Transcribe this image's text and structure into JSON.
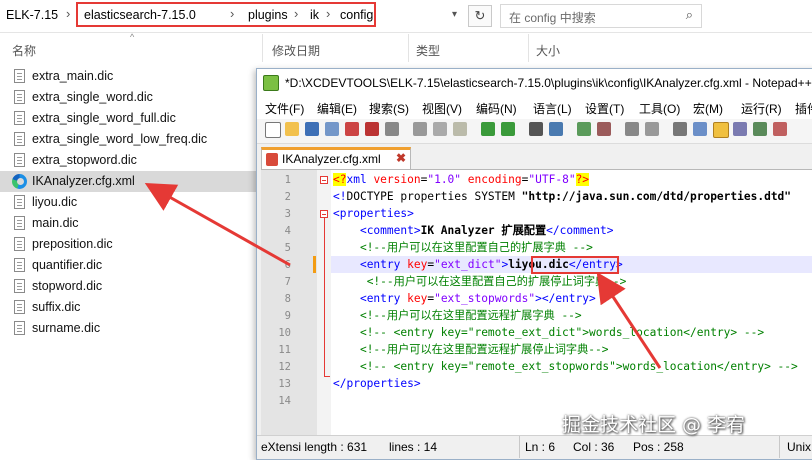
{
  "explorer": {
    "crumbs": [
      "ELK-7.15",
      "elasticsearch-7.15.0",
      "plugins",
      "ik",
      "config"
    ],
    "search_placeholder": "在 config 中搜索",
    "columns": {
      "name": "名称",
      "modified": "修改日期",
      "type": "类型",
      "size": "大小"
    },
    "files": [
      {
        "name": "extra_main.dic",
        "icon": "document-icon"
      },
      {
        "name": "extra_single_word.dic",
        "icon": "document-icon"
      },
      {
        "name": "extra_single_word_full.dic",
        "icon": "document-icon"
      },
      {
        "name": "extra_single_word_low_freq.dic",
        "icon": "document-icon"
      },
      {
        "name": "extra_stopword.dic",
        "icon": "document-icon"
      },
      {
        "name": "IKAnalyzer.cfg.xml",
        "icon": "edge-icon",
        "selected": true
      },
      {
        "name": "liyou.dic",
        "icon": "document-icon"
      },
      {
        "name": "main.dic",
        "icon": "document-icon"
      },
      {
        "name": "preposition.dic",
        "icon": "document-icon"
      },
      {
        "name": "quantifier.dic",
        "icon": "document-icon"
      },
      {
        "name": "stopword.dic",
        "icon": "document-icon"
      },
      {
        "name": "suffix.dic",
        "icon": "document-icon"
      },
      {
        "name": "surname.dic",
        "icon": "document-icon"
      }
    ]
  },
  "notepad": {
    "title": "*D:\\XCDEVTOOLS\\ELK-7.15\\elasticsearch-7.15.0\\plugins\\ik\\config\\IKAnalyzer.cfg.xml - Notepad++",
    "menu": [
      "文件(F)",
      "编辑(E)",
      "搜索(S)",
      "视图(V)",
      "编码(N)",
      "语言(L)",
      "设置(T)",
      "工具(O)",
      "宏(M)",
      "运行(R)",
      "插件"
    ],
    "tab_label": "IKAnalyzer.cfg.xml",
    "tab_close": "✖",
    "line_numbers": [
      "1",
      "2",
      "3",
      "4",
      "5",
      "6",
      "7",
      "8",
      "9",
      "10",
      "11",
      "12",
      "13",
      "14"
    ],
    "code": [
      [
        {
          "c": "pi",
          "t": "<?"
        },
        {
          "c": "tag",
          "t": "xml "
        },
        {
          "c": "attr",
          "t": "version"
        },
        {
          "c": "txt",
          "t": "="
        },
        {
          "c": "val",
          "t": "\"1.0\""
        },
        {
          "c": "attr",
          "t": " encoding"
        },
        {
          "c": "txt",
          "t": "="
        },
        {
          "c": "val",
          "t": "\"UTF-8\""
        },
        {
          "c": "pi",
          "t": "?>"
        }
      ],
      [
        {
          "c": "tag",
          "t": "<!"
        },
        {
          "c": "txt",
          "t": "DOCTYPE properties SYSTEM "
        },
        {
          "c": "bold",
          "t": "\"http://java.sun.com/dtd/properties.dtd\""
        }
      ],
      [
        {
          "c": "tag",
          "t": "<properties>"
        }
      ],
      [
        {
          "c": "txt",
          "t": "    "
        },
        {
          "c": "tag",
          "t": "<comment>"
        },
        {
          "c": "bold",
          "t": "IK Analyzer 扩展配置"
        },
        {
          "c": "tag",
          "t": "</comment>"
        }
      ],
      [
        {
          "c": "txt",
          "t": "    "
        },
        {
          "c": "cmt",
          "t": "<!--用户可以在这里配置自己的扩展字典 -->"
        }
      ],
      [
        {
          "c": "txt",
          "t": "    "
        },
        {
          "c": "tag",
          "t": "<entry "
        },
        {
          "c": "attr",
          "t": "key"
        },
        {
          "c": "txt",
          "t": "="
        },
        {
          "c": "val",
          "t": "\"ext_dict\""
        },
        {
          "c": "tag",
          "t": ">"
        },
        {
          "c": "bold",
          "t": "liyou.dic"
        },
        {
          "c": "tag",
          "t": "</entry>"
        }
      ],
      [
        {
          "c": "txt",
          "t": "     "
        },
        {
          "c": "cmt",
          "t": "<!--用户可以在这里配置自己的扩展停止词字典-->"
        }
      ],
      [
        {
          "c": "txt",
          "t": "    "
        },
        {
          "c": "tag",
          "t": "<entry "
        },
        {
          "c": "attr",
          "t": "key"
        },
        {
          "c": "txt",
          "t": "="
        },
        {
          "c": "val",
          "t": "\"ext_stopwords\""
        },
        {
          "c": "tag",
          "t": "></entry>"
        }
      ],
      [
        {
          "c": "txt",
          "t": "    "
        },
        {
          "c": "cmt",
          "t": "<!--用户可以在这里配置远程扩展字典 -->"
        }
      ],
      [
        {
          "c": "txt",
          "t": "    "
        },
        {
          "c": "cmt",
          "t": "<!-- <entry key=\"remote_ext_dict\">words_location</entry> -->"
        }
      ],
      [
        {
          "c": "txt",
          "t": "    "
        },
        {
          "c": "cmt",
          "t": "<!--用户可以在这里配置远程扩展停止词字典-->"
        }
      ],
      [
        {
          "c": "txt",
          "t": "    "
        },
        {
          "c": "cmt",
          "t": "<!-- <entry key=\"remote_ext_stopwords\">words_location</entry> -->"
        }
      ],
      [
        {
          "c": "tag",
          "t": "</properties>"
        }
      ],
      []
    ],
    "status": {
      "type": "eXtensi length : 631",
      "lines": "lines : 14",
      "ln": "Ln : 6",
      "col": "Col : 36",
      "pos": "Pos : 258",
      "eol": "Unix"
    }
  },
  "watermark": "掘金技术社区 @ 李宥",
  "colors": {
    "annotation": "#e53935",
    "tab_accent": "#f0a030",
    "selection": "#d9d9d9"
  }
}
